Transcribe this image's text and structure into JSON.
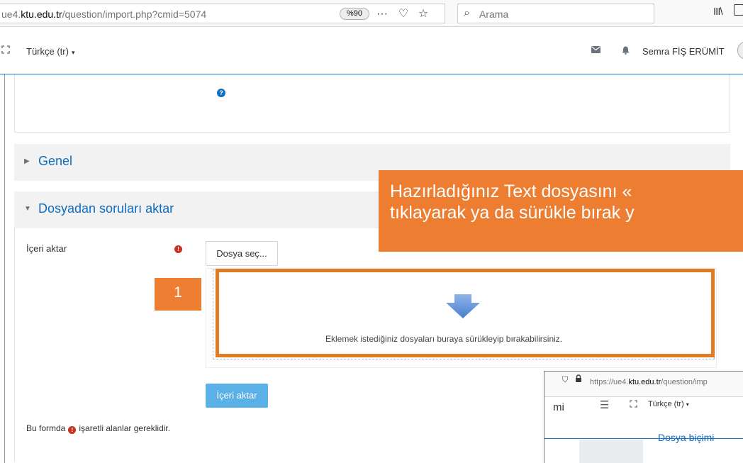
{
  "browser": {
    "url_prefix": "ue4.",
    "url_domain": "ktu.edu.tr",
    "url_path": "/question/import.php?cmid=5074",
    "zoom": "%90",
    "search_placeholder": "Arama",
    "menu_glyph": "···",
    "pocket_glyph": "♡",
    "bookmark_glyph": "☆",
    "search_glyph": "⌕",
    "library_glyph": "III\\"
  },
  "navbar": {
    "language": "Türkçe (tr)",
    "user_name": "Semra FİŞ ERÜMİT"
  },
  "form": {
    "help_glyph": "?",
    "section_general": "Genel",
    "section_import": "Dosyadan soruları aktar",
    "import_label": "İçeri aktar",
    "required_glyph": "!",
    "choose_file_button": "Dosya seç...",
    "drop_text": "Eklemek istediğiniz dosyaları buraya sürükleyip bırakabilirsiniz.",
    "submit_button": "İçeri aktar",
    "footnote_before": "Bu formda",
    "footnote_after": "işaretli alanlar gereklidir."
  },
  "annotation": {
    "step_number": "1",
    "callout_line1": "Hazırladığınız Text dosyasını «",
    "callout_line2": "tıklayarak ya da sürükle bırak y"
  },
  "inset_window": {
    "url_prefix": "https://ue4.",
    "url_domain": "ktu.edu.tr",
    "url_path": "/question/imp",
    "left_text": "mi",
    "language": "Türkçe (tr)",
    "heading": "Dosya biçimi"
  },
  "colors": {
    "accent_orange": "#ed7d31",
    "link_blue": "#0f6cbf",
    "button_blue": "#5ab1e8",
    "required_red": "#ca3120"
  }
}
